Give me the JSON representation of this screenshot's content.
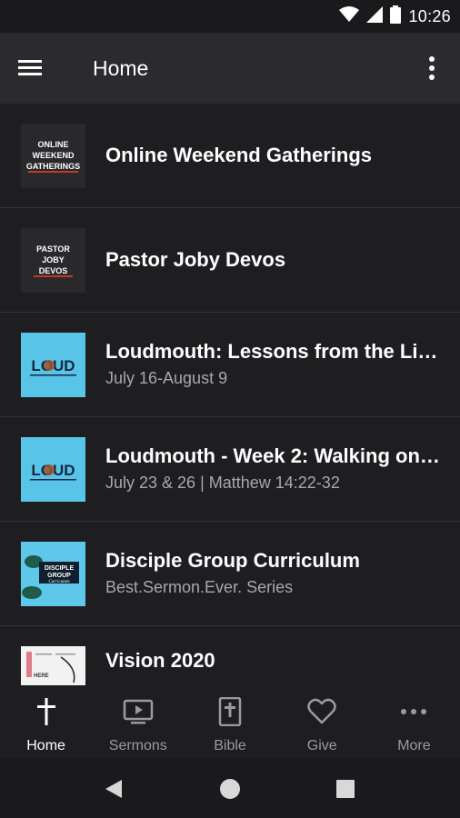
{
  "status_bar": {
    "time": "10:26",
    "icons": [
      "wifi-icon",
      "cell-signal-icon",
      "battery-icon"
    ]
  },
  "app_bar": {
    "title": "Home",
    "menu_icon": "hamburger-menu-icon",
    "overflow_icon": "overflow-menu-icon"
  },
  "list": {
    "items": [
      {
        "title": "Online Weekend Gatherings",
        "subtitle": "",
        "thumb_text": [
          "ONLINE",
          "WEEKEND",
          "GATHERINGS"
        ]
      },
      {
        "title": "Pastor Joby Devos",
        "subtitle": "",
        "thumb_text": [
          "PASTOR",
          "JOBY",
          "DEVOS"
        ]
      },
      {
        "title": "Loudmouth: Lessons from the Li…",
        "subtitle": "July 16-August 9",
        "thumb_text": "LOUD"
      },
      {
        "title": "Loudmouth - Week 2: Walking on…",
        "subtitle": "July 23 & 26 | Matthew 14:22-32",
        "thumb_text": "LOUD"
      },
      {
        "title": "Disciple Group Curriculum",
        "subtitle": "Best.Sermon.Ever. Series",
        "thumb_text": [
          "DISCIPLE",
          "GROUP",
          "Curriculum"
        ]
      },
      {
        "title": "Vision 2020",
        "subtitle": "",
        "thumb_text": [
          "HERE"
        ]
      }
    ]
  },
  "bottom_nav": {
    "items": [
      {
        "label": "Home",
        "icon": "cross-icon",
        "active": true
      },
      {
        "label": "Sermons",
        "icon": "video-play-icon",
        "active": false
      },
      {
        "label": "Bible",
        "icon": "bible-icon",
        "active": false
      },
      {
        "label": "Give",
        "icon": "heart-icon",
        "active": false
      },
      {
        "label": "More",
        "icon": "more-dots-icon",
        "active": false
      }
    ]
  },
  "system_nav": {
    "icons": [
      "back-icon",
      "home-circle-icon",
      "recents-icon"
    ]
  },
  "colors": {
    "background": "#1e1e20",
    "app_bar": "#2b2b2d",
    "loud_thumb": "#58c5e8",
    "disciple_thumb": "#5ec8ea",
    "secondary_text": "#a8a8aa"
  }
}
